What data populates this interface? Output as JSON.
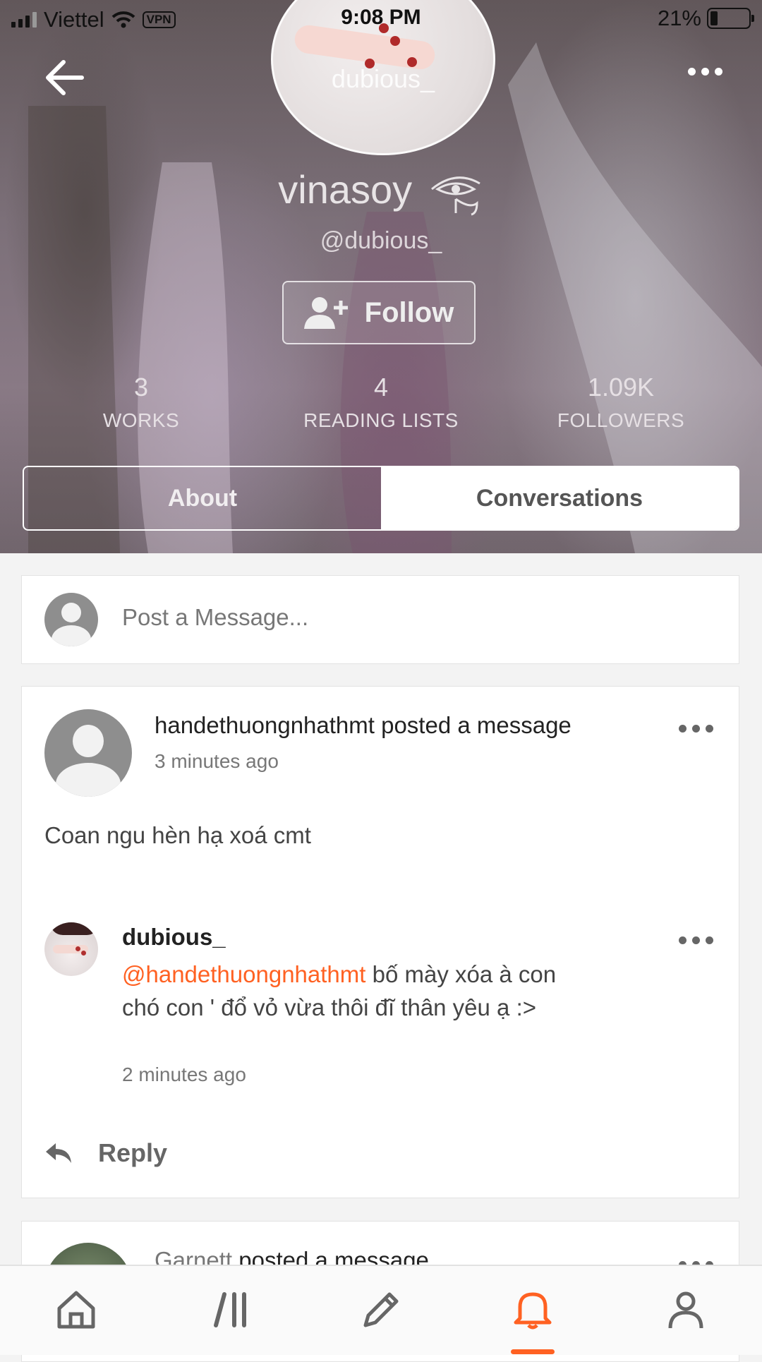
{
  "status_bar": {
    "carrier": "Viettel",
    "vpn": "VPN",
    "time": "9:08 PM",
    "battery": "21%"
  },
  "profile": {
    "avatar_overlay_text": "dubious_",
    "display_name": "vinasoy",
    "handle": "@dubious_",
    "follow_label": "Follow",
    "stats": [
      {
        "value": "3",
        "label": "WORKS"
      },
      {
        "value": "4",
        "label": "READING LISTS"
      },
      {
        "value": "1.09K",
        "label": "FOLLOWERS"
      }
    ],
    "tabs": [
      {
        "label": "About",
        "active": false
      },
      {
        "label": "Conversations",
        "active": true
      }
    ]
  },
  "composer": {
    "placeholder": "Post a Message..."
  },
  "messages": [
    {
      "title": "handethuongnhathmt posted a message",
      "time": "3 minutes ago",
      "body": "Coan ngu hèn hạ xoá cmt",
      "replies": [
        {
          "author": "dubious_",
          "mention": "@handethuongnhathmt",
          "text": " bố mày xóa à con chó con ' đổ vỏ vừa thôi đĩ thân yêu ạ :>",
          "time": "2 minutes ago"
        }
      ],
      "reply_label": "Reply"
    },
    {
      "author": "Garnett",
      "title_suffix": "posted a message"
    }
  ],
  "nav": {
    "items": [
      "home-icon",
      "library-icon",
      "write-icon",
      "notifications-icon",
      "profile-icon"
    ],
    "active": "notifications-icon"
  },
  "colors": {
    "accent": "#ff6122",
    "icon_gray": "#666666",
    "card_bg": "#ffffff",
    "page_bg": "#f3f3f3"
  }
}
